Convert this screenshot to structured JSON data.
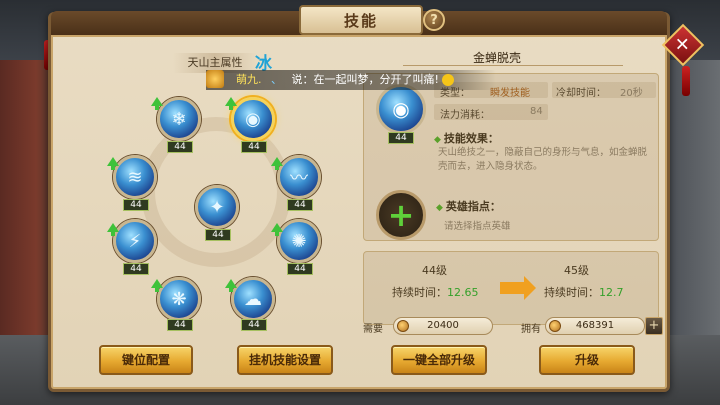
{
  "window": {
    "title": "技能",
    "help_label": "?",
    "close_label": "✕"
  },
  "left": {
    "attr_label": "天山主属性",
    "attr_value": "冰",
    "skills": [
      {
        "id": "skill-1",
        "level": "44",
        "glyph": "❄",
        "upgradable": true
      },
      {
        "id": "skill-2",
        "level": "44",
        "glyph": "◉",
        "upgradable": true,
        "selected": true
      },
      {
        "id": "skill-3",
        "level": "44",
        "glyph": "≋",
        "upgradable": true
      },
      {
        "id": "skill-4",
        "level": "44",
        "glyph": "〰",
        "upgradable": true
      },
      {
        "id": "skill-5",
        "level": "44",
        "glyph": "✦",
        "upgradable": true
      },
      {
        "id": "skill-6",
        "level": "44",
        "glyph": "⚡",
        "upgradable": true
      },
      {
        "id": "skill-7",
        "level": "44",
        "glyph": "✺",
        "upgradable": true
      },
      {
        "id": "skill-8",
        "level": "44",
        "glyph": "❋",
        "upgradable": true
      },
      {
        "id": "skill-9",
        "level": "44",
        "glyph": "☁",
        "upgradable": true
      }
    ]
  },
  "chat": {
    "name": "萌九.",
    "separator": "、",
    "message": "说：在一起叫梦，分开了叫痛!"
  },
  "detail": {
    "skill_name": "金蝉脱壳",
    "cast_type_label": "类型：",
    "cast_type_value": "瞬发技能",
    "cooldown_label": "冷却时间：",
    "cooldown_value": "20秒",
    "mana_label": "法力消耗：",
    "mana_value": "84",
    "skill_level": "44",
    "effect_title": "技能效果：",
    "effect_desc": "天山绝技之一，隐蔽自己的身形与气息，如金蝉脱壳而去，进入隐身状态。",
    "hero_title": "英雄指点：",
    "hero_desc": "请选择指点英雄"
  },
  "compare": {
    "current_level": "44级",
    "next_level": "45级",
    "duration_label": "持续时间：",
    "current_duration": "12.65",
    "next_duration": "12.7"
  },
  "cost": {
    "need_label": "需要",
    "need_value": "20400",
    "have_label": "拥有",
    "have_value": "468391",
    "add_label": "+"
  },
  "buttons": {
    "key_config": "键位配置",
    "auto_skill": "挂机技能设置",
    "upgrade_all": "一键全部升级",
    "upgrade": "升级"
  },
  "colors": {
    "accent_ice": "#1fa3d6",
    "green_value": "#35a02a",
    "button_gold": "#e6a930"
  }
}
